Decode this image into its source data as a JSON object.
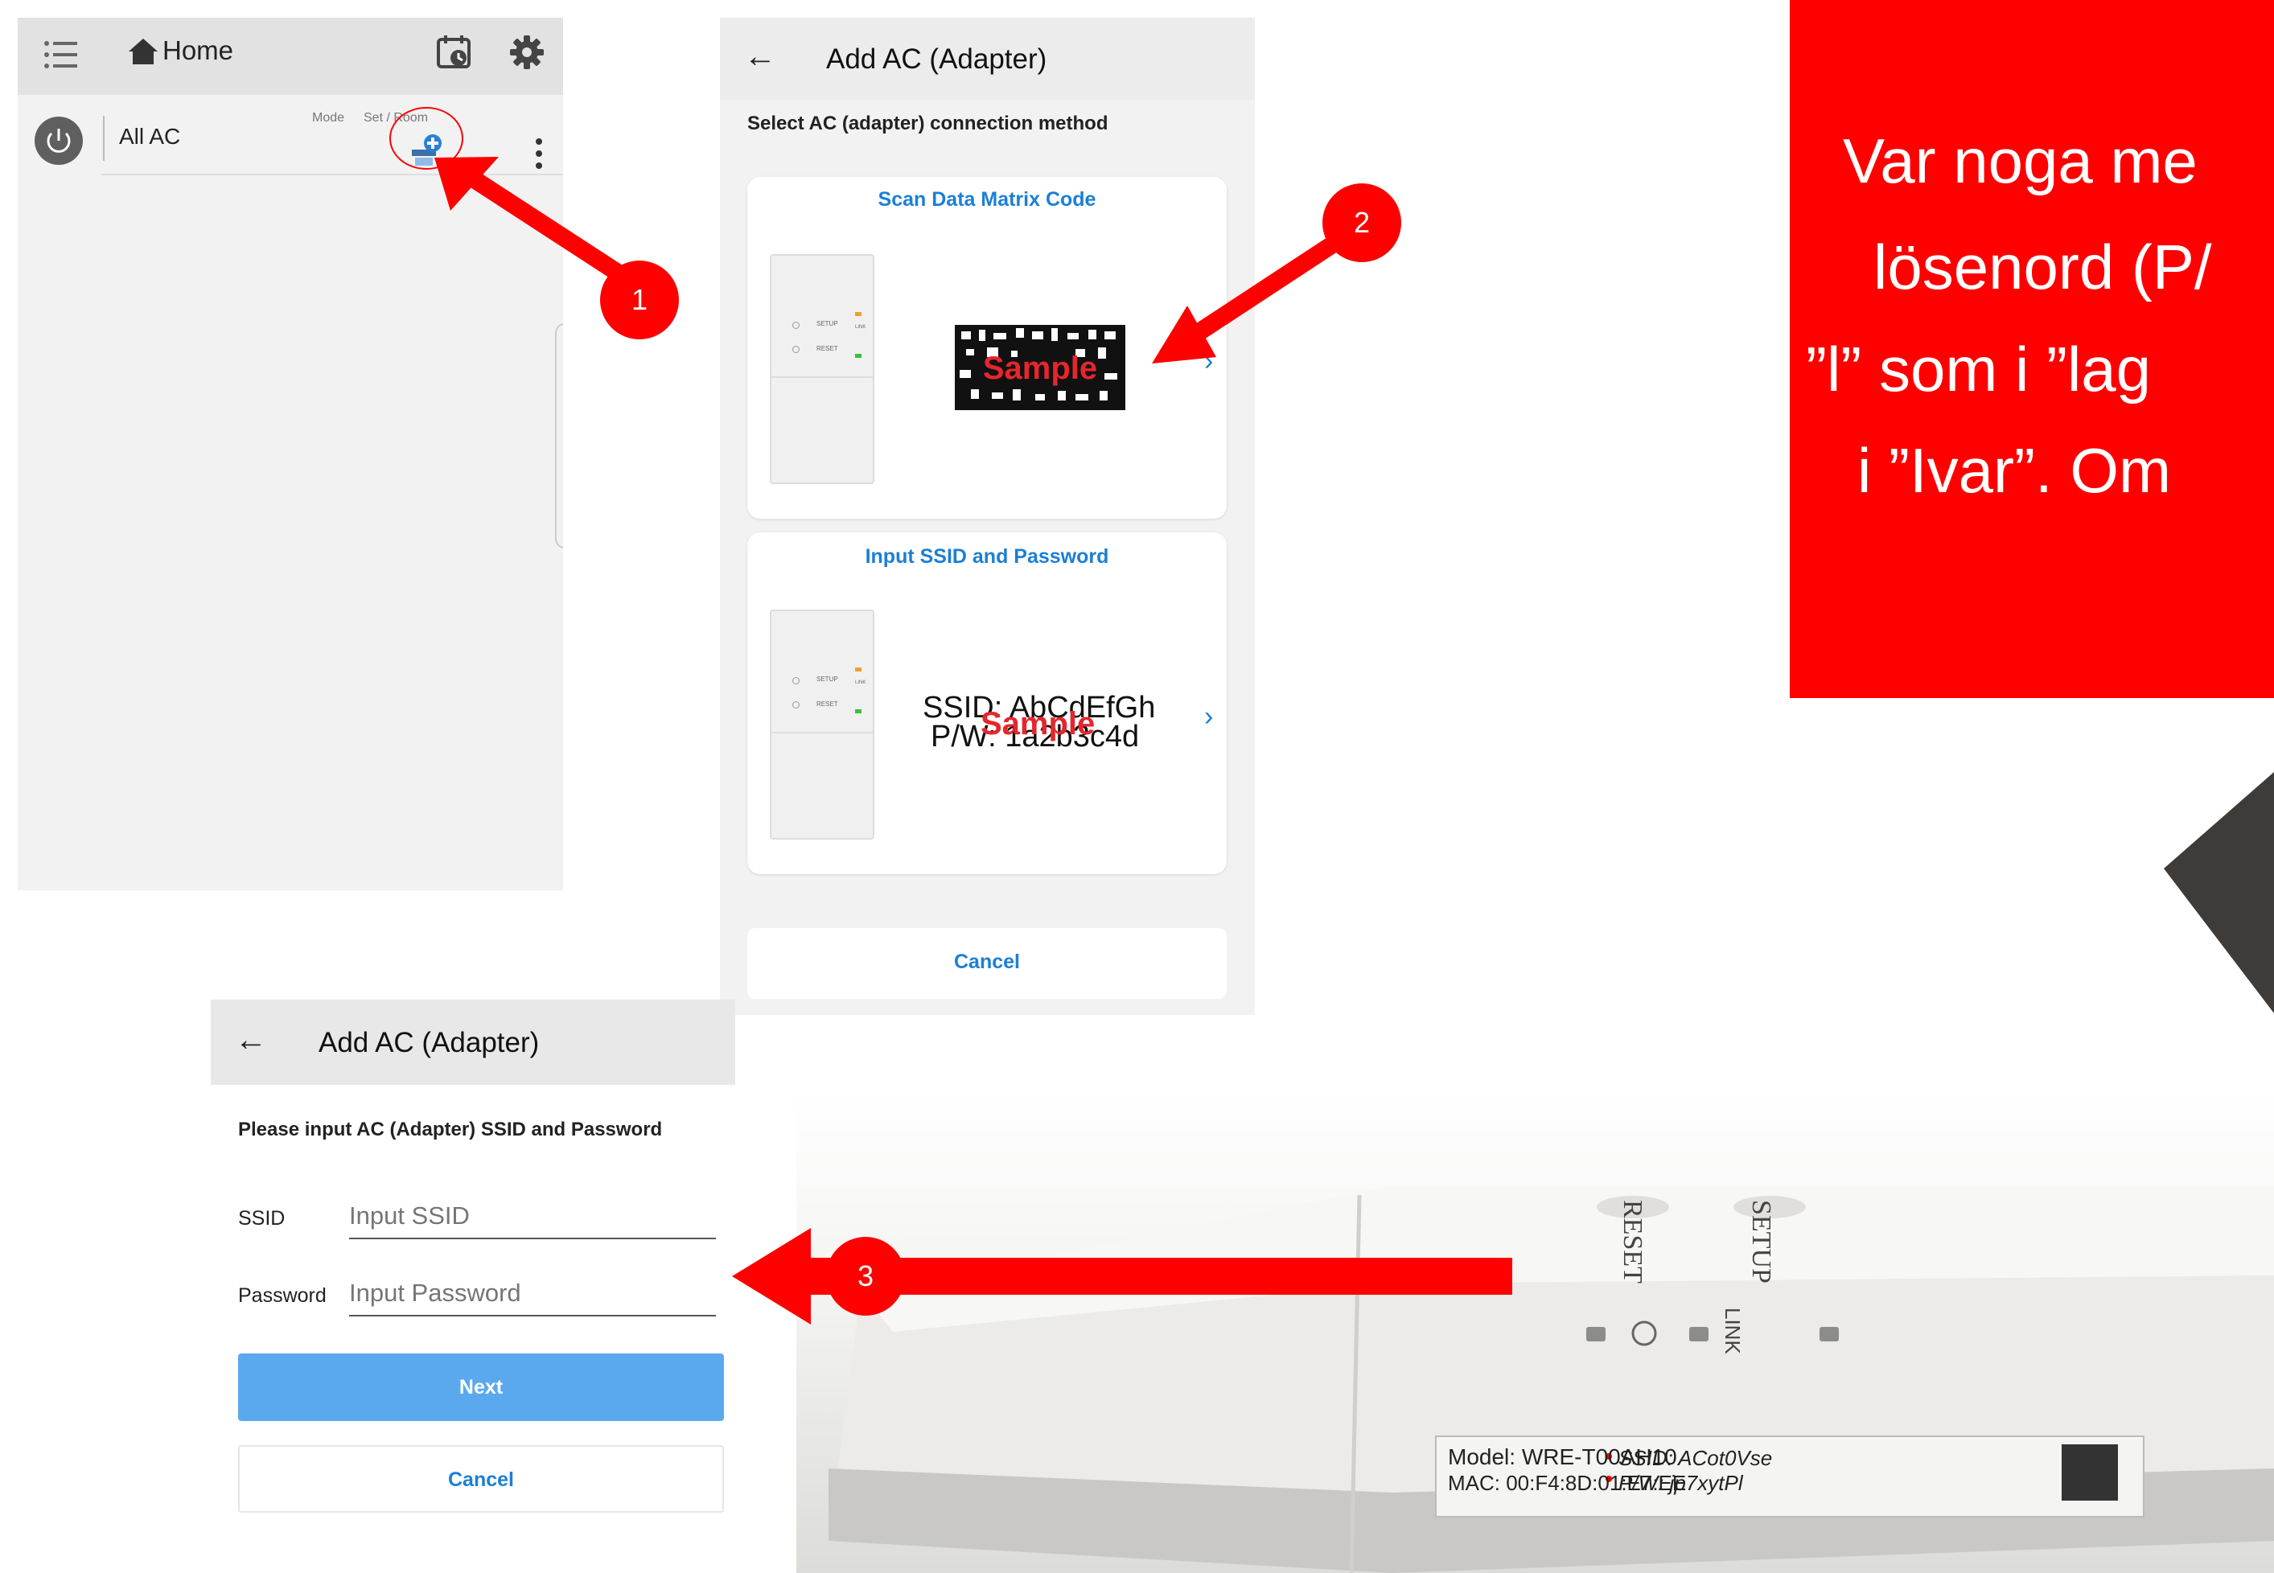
{
  "screen1": {
    "title": "Home",
    "row_label": "All AC",
    "mode_label": "Mode",
    "set_room_label": "Set / Room"
  },
  "screen2": {
    "title": "Add AC (Adapter)",
    "subtitle": "Select AC (adapter) connection method",
    "option1_title": "Scan Data Matrix Code",
    "option1_watermark": "Sample",
    "option2_title": "Input SSID and Password",
    "ssid_sample": "SSID: AbCdEfGh",
    "pw_sample": "P/W: 1a2b3c4d",
    "option2_watermark": "Sample",
    "device_labels": [
      "SETUP",
      "RESET",
      "LINK"
    ],
    "cancel": "Cancel"
  },
  "screen3": {
    "title": "Add AC (Adapter)",
    "subtitle": "Please input AC (Adapter) SSID and Password",
    "ssid_label": "SSID",
    "ssid_placeholder": "Input SSID",
    "password_label": "Password",
    "password_placeholder": "Input Password",
    "next": "Next",
    "cancel": "Cancel"
  },
  "badges": [
    "1",
    "2",
    "3"
  ],
  "note": {
    "lines": [
      "Var noga me",
      "lösenord (P/",
      "”l” som i ”lag",
      "i ”Ivar”. Om"
    ]
  },
  "adapter_photo": {
    "reset": "RESET",
    "setup": "SETUP",
    "link": "LINK",
    "model": "Model:  WRE-T00AH10",
    "mac": "MAC:  00:F4:8D:01:E7:EE",
    "ssid": "SSID:  ACot0Vse",
    "pw": "P/W:  jp7xytPl"
  },
  "colors": {
    "accent_red": "#ff0000",
    "link_blue": "#1b7fd6",
    "next_button": "#5aa9ee"
  }
}
